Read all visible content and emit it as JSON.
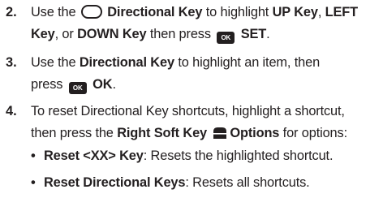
{
  "steps": [
    {
      "number": "2.",
      "lines": [
        [
          "Use the ",
          "",
          " Directional Key",
          " to highlight ",
          "UP Key",
          ", ",
          "LEFT"
        ],
        [
          "Key",
          ", or ",
          "DOWN Key",
          " then press ",
          "OK",
          " SET",
          "."
        ]
      ]
    },
    {
      "number": "3.",
      "lines": [
        [
          "Use the ",
          "Directional Key",
          " to highlight an item, then"
        ],
        [
          "press ",
          "OK",
          " OK",
          "."
        ]
      ]
    },
    {
      "number": "4.",
      "lines": [
        [
          "To reset Directional Key shortcuts, highlight a shortcut,"
        ],
        [
          "then press the ",
          "Right Soft Key",
          " ",
          "Options",
          " for options:"
        ]
      ],
      "bullets": [
        {
          "bold": "Reset <XX> Key",
          "text": ": Resets the highlighted shortcut."
        },
        {
          "bold": "Reset Directional Keys",
          "text": ": Resets all shortcuts."
        }
      ]
    }
  ],
  "icons": {
    "directional": "directional-key-icon",
    "ok": "ok-key-icon",
    "soft": "right-soft-key-icon"
  }
}
